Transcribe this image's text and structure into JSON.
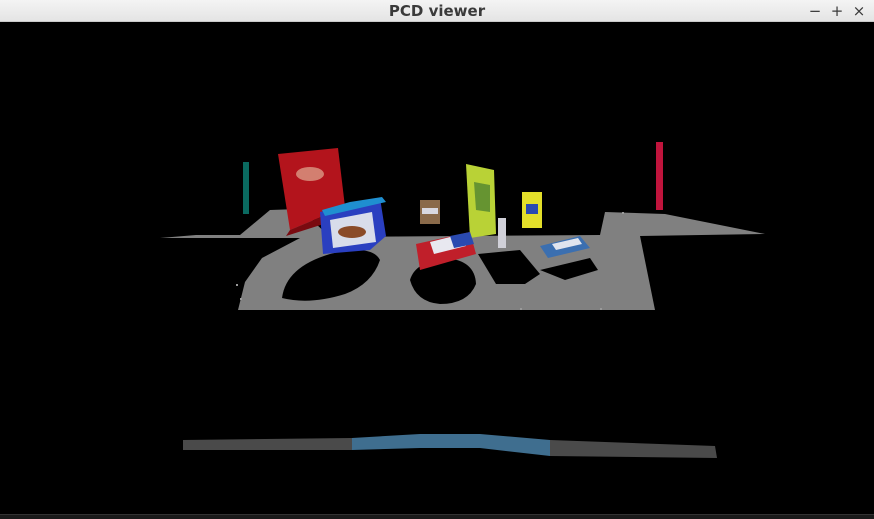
{
  "window": {
    "title": "PCD viewer",
    "controls": {
      "minimize": "−",
      "maximize": "+",
      "close": "×"
    }
  },
  "scene": {
    "background": "#000000",
    "table_color": "#808080",
    "floor_strip_color": "#4a4a4a",
    "floor_strip_highlight": "#3f6e8f",
    "objects": [
      {
        "name": "red-cereal-box",
        "color": "#b3141c"
      },
      {
        "name": "blue-white-box",
        "color": "#2a3fc0"
      },
      {
        "name": "yellow-green-box",
        "color": "#b9d236"
      },
      {
        "name": "small-yellow-can",
        "color": "#e3df2a"
      },
      {
        "name": "red-white-pack",
        "color": "#c01f2a"
      },
      {
        "name": "small-cup",
        "color": "#8a6a4a"
      },
      {
        "name": "blue-flat-pack",
        "color": "#3b6fb0"
      },
      {
        "name": "teal-pole",
        "color": "#0a6a60"
      },
      {
        "name": "red-pole",
        "color": "#c0143c"
      }
    ]
  }
}
